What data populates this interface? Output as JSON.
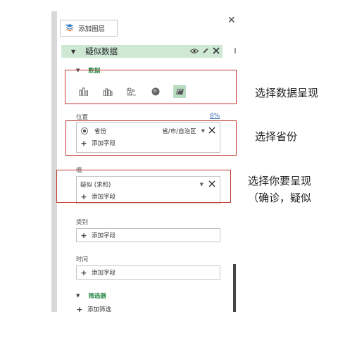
{
  "toolbar": {
    "add_layer_label": "添加图层",
    "close_icon": "close-icon"
  },
  "layer": {
    "title": "疑似数据"
  },
  "data_section": {
    "title": "数据"
  },
  "location": {
    "label": "位置",
    "percent": "8%",
    "field_name": "省份",
    "field_type": "省/市/自治区",
    "add_field_label": "添加字段"
  },
  "value": {
    "label": "值",
    "field_name": "疑似 (求和)",
    "add_field_label": "添加字段"
  },
  "category": {
    "label": "类别",
    "add_field_label": "添加字段"
  },
  "time": {
    "label": "时间",
    "add_field_label": "添加字段"
  },
  "filter": {
    "title": "筛选器",
    "add_filter_label": "添加筛选"
  },
  "annotations": {
    "line1": "选择数据呈现",
    "line2": "选择省份",
    "line3": "选择你要呈现",
    "line4": "（确诊，疑似"
  },
  "colors": {
    "accent": "#2c8a4a",
    "header_bg": "#cfe8d4",
    "highlight": "#c0392b"
  }
}
